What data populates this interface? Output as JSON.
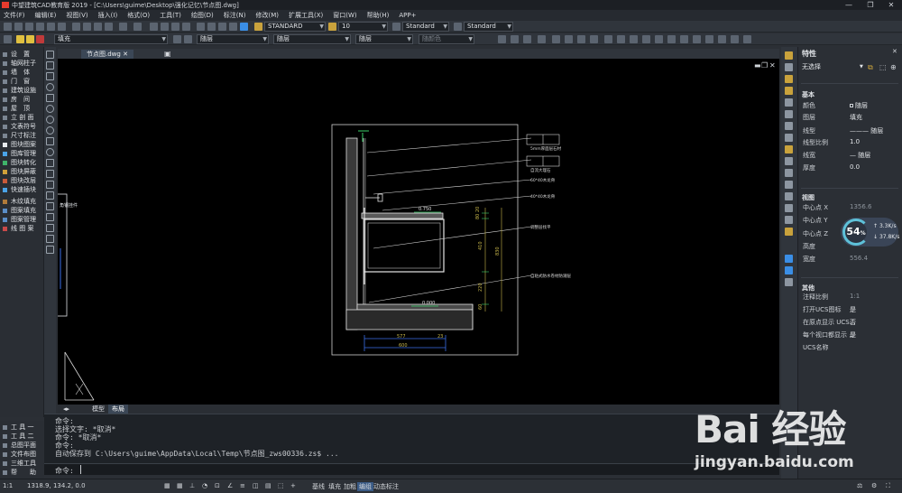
{
  "window": {
    "title": "中望建筑CAD教育版 2019 - [C:\\Users\\guime\\Desktop\\强化记忆\\节点图.dwg]"
  },
  "menu": [
    "文件(F)",
    "编辑(E)",
    "视图(V)",
    "插入(I)",
    "格式(O)",
    "工具(T)",
    "绘图(D)",
    "标注(N)",
    "修改(M)",
    "扩展工具(X)",
    "窗口(W)",
    "帮助(H)",
    "APP+"
  ],
  "toolbar": {
    "textstyle": "STANDARD",
    "textsize": "10",
    "dimstyle": "Standard",
    "tablestyle": "Standard",
    "layer_name": "填充",
    "color": "随层",
    "linetype": "随层",
    "lineweight": "随层",
    "plotstyle": "随颜色"
  },
  "left_panel": {
    "items": [
      "设　置",
      "轴网柱子",
      "墙　体",
      "门　窗",
      "建筑设施",
      "房　间",
      "屋　顶",
      "立 剖 面",
      "文表符号",
      "尺寸标注",
      "图块图案",
      "图库管理",
      "图块转化",
      "图块屏蔽",
      "图块改层",
      "快速插块",
      "木纹填充",
      "图案填充",
      "图案管理",
      "线 图 案"
    ],
    "bottom_items": [
      "工 具 一",
      "工 具 二",
      "总图平面",
      "文件布图",
      "三维工具",
      "帮　　助"
    ]
  },
  "drawing_tab": "节点图.dwg",
  "layout_tabs": [
    "模型",
    "布局"
  ],
  "drawing": {
    "left_label": "角钢挂件",
    "annotations": [
      "5mm厚面层石材",
      "自流大理石",
      "60*40木龙骨",
      "40*40木龙骨",
      "调整层找平",
      "自粘式防水卷材防潮层",
      "0.750",
      "0.000"
    ],
    "dims_v": [
      "20",
      "80",
      "410",
      "830",
      "220",
      "60"
    ],
    "dims_h": [
      "577",
      "23",
      "600"
    ]
  },
  "command": {
    "lines": [
      "命令:",
      "选择文字: *取消*",
      "命令: *取消*",
      "命令:",
      "自动保存到 C:\\Users\\guime\\AppData\\Local\\Temp\\节点图_zws00336.zs$ ..."
    ],
    "prompt": "命令:"
  },
  "status": {
    "scale": "1:1",
    "coords": "1318.9, 134.2, 0.0",
    "toggles": [
      "基线",
      "填充",
      "加粗",
      "编组",
      "动态标注"
    ]
  },
  "properties": {
    "title": "特性",
    "selection": "无选择",
    "sections": {
      "basic": "基本",
      "view": "视图",
      "other": "其他"
    },
    "basic": [
      {
        "k": "颜色",
        "v": "随层"
      },
      {
        "k": "图层",
        "v": "填充"
      },
      {
        "k": "线型",
        "v": "——— 随层"
      },
      {
        "k": "线型比例",
        "v": "1.0"
      },
      {
        "k": "线宽",
        "v": "— 随层"
      },
      {
        "k": "厚度",
        "v": "0.0"
      }
    ],
    "view": [
      {
        "k": "中心点 X",
        "v": "1356.6"
      },
      {
        "k": "中心点 Y",
        "v": ""
      },
      {
        "k": "中心点 Z",
        "v": ""
      },
      {
        "k": "高度",
        "v": ""
      },
      {
        "k": "宽度",
        "v": "556.4"
      }
    ],
    "other": [
      {
        "k": "注释比例",
        "v": "1:1"
      },
      {
        "k": "打开UCS图标",
        "v": "是"
      },
      {
        "k": "在原点显示 UCS...",
        "v": "否"
      },
      {
        "k": "每个视口都显示 ...",
        "v": "是"
      },
      {
        "k": "UCS名称",
        "v": ""
      }
    ]
  },
  "gauge": {
    "value": "54",
    "unit": "%",
    "up": "3.3",
    "up_unit": "K/s",
    "down": "37.8",
    "down_unit": "K/s"
  },
  "watermark": {
    "brand": "Bai 经验",
    "url": "jingyan.baidu.com"
  }
}
